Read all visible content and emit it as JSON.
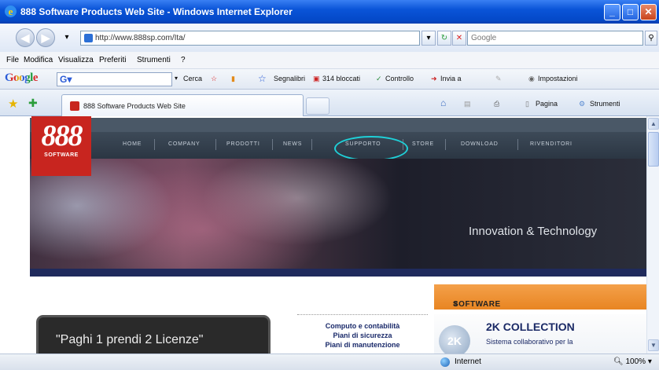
{
  "window": {
    "title": "888 Software Products Web Site - Windows Internet Explorer"
  },
  "address_bar": {
    "url": "http://www.888sp.com/Ita/",
    "search_placeholder": "Google"
  },
  "menu": [
    "File",
    "Modifica",
    "Visualizza",
    "Preferiti",
    "Strumenti",
    "?"
  ],
  "google_toolbar": {
    "logo": "Google",
    "search_label": "Cerca",
    "bookmarks_label": "Segnalibri",
    "blocked_label": "314 bloccati",
    "check_label": "Controllo",
    "send_label": "Invia a",
    "settings_label": "Impostazioni"
  },
  "tabbar": {
    "tab_title": "888 Software Products Web Site",
    "page_label": "Pagina",
    "tools_label": "Strumenti"
  },
  "site": {
    "logo_number": "888",
    "logo_word": "SOFTWARE",
    "nav": [
      "HOME",
      "COMPANY",
      "PRODOTTI",
      "NEWS",
      "SUPPORTO",
      "STORE",
      "DOWNLOAD",
      "RIVENDITORI"
    ],
    "highlighted_nav": "SUPPORTO",
    "banner_tagline": "Innovation & Technology",
    "software_header": "SOFTWARE",
    "promo_text": "\"Paghi 1 prendi 2 Licenze\"",
    "center_links": [
      "Computo e contabilità",
      "Piani di sicurezza",
      "Piani di manutenzione"
    ],
    "product_title": "2K COLLECTION",
    "product_subtitle": "Sistema collaborativo per la"
  },
  "status_bar": {
    "zone": "Internet",
    "zoom": "100%"
  }
}
